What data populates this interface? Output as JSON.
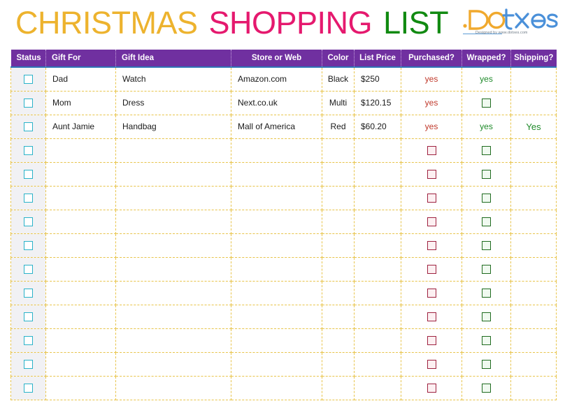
{
  "title": {
    "word1": "CHRISTMAS",
    "word2": "SHOPPING",
    "word3": "LIST",
    "color1": "#edb32e",
    "color2": "#e5196e",
    "color3": "#118a11"
  },
  "logo": {
    "text": ".Dotxes",
    "tagline": "Designed by www.dotxes.com"
  },
  "table": {
    "header_bg": "#7030a0",
    "grid_color": "#e8c44a",
    "columns": [
      "Status",
      "Gift For",
      "Gift Idea",
      "Store or Web",
      "Color",
      "List Price",
      "Purchased?",
      "Wrapped?",
      "Shipping?"
    ],
    "rows": [
      {
        "status": "checkbox",
        "gift_for": "Dad",
        "gift_idea": "Watch",
        "store": "Amazon.com",
        "color": "Black",
        "price": "$250",
        "purchased": "yes",
        "wrapped": "yes",
        "shipping": ""
      },
      {
        "status": "checkbox",
        "gift_for": "Mom",
        "gift_idea": "Dress",
        "store": "Next.co.uk",
        "color": "Multi",
        "price": "$120.15",
        "purchased": "yes",
        "wrapped": "checkbox",
        "shipping": ""
      },
      {
        "status": "checkbox",
        "gift_for": "Aunt Jamie",
        "gift_idea": "Handbag",
        "store": "Mall of America",
        "color": "Red",
        "price": "$60.20",
        "purchased": "yes",
        "wrapped": "yes",
        "shipping": "Yes"
      },
      {
        "status": "checkbox",
        "gift_for": "",
        "gift_idea": "",
        "store": "",
        "color": "",
        "price": "",
        "purchased": "checkbox",
        "wrapped": "checkbox",
        "shipping": ""
      },
      {
        "status": "checkbox",
        "gift_for": "",
        "gift_idea": "",
        "store": "",
        "color": "",
        "price": "",
        "purchased": "checkbox",
        "wrapped": "checkbox",
        "shipping": ""
      },
      {
        "status": "checkbox",
        "gift_for": "",
        "gift_idea": "",
        "store": "",
        "color": "",
        "price": "",
        "purchased": "checkbox",
        "wrapped": "checkbox",
        "shipping": ""
      },
      {
        "status": "checkbox",
        "gift_for": "",
        "gift_idea": "",
        "store": "",
        "color": "",
        "price": "",
        "purchased": "checkbox",
        "wrapped": "checkbox",
        "shipping": ""
      },
      {
        "status": "checkbox",
        "gift_for": "",
        "gift_idea": "",
        "store": "",
        "color": "",
        "price": "",
        "purchased": "checkbox",
        "wrapped": "checkbox",
        "shipping": ""
      },
      {
        "status": "checkbox",
        "gift_for": "",
        "gift_idea": "",
        "store": "",
        "color": "",
        "price": "",
        "purchased": "checkbox",
        "wrapped": "checkbox",
        "shipping": ""
      },
      {
        "status": "checkbox",
        "gift_for": "",
        "gift_idea": "",
        "store": "",
        "color": "",
        "price": "",
        "purchased": "checkbox",
        "wrapped": "checkbox",
        "shipping": ""
      },
      {
        "status": "checkbox",
        "gift_for": "",
        "gift_idea": "",
        "store": "",
        "color": "",
        "price": "",
        "purchased": "checkbox",
        "wrapped": "checkbox",
        "shipping": ""
      },
      {
        "status": "checkbox",
        "gift_for": "",
        "gift_idea": "",
        "store": "",
        "color": "",
        "price": "",
        "purchased": "checkbox",
        "wrapped": "checkbox",
        "shipping": ""
      },
      {
        "status": "checkbox",
        "gift_for": "",
        "gift_idea": "",
        "store": "",
        "color": "",
        "price": "",
        "purchased": "checkbox",
        "wrapped": "checkbox",
        "shipping": ""
      },
      {
        "status": "checkbox",
        "gift_for": "",
        "gift_idea": "",
        "store": "",
        "color": "",
        "price": "",
        "purchased": "checkbox",
        "wrapped": "checkbox",
        "shipping": ""
      }
    ]
  }
}
